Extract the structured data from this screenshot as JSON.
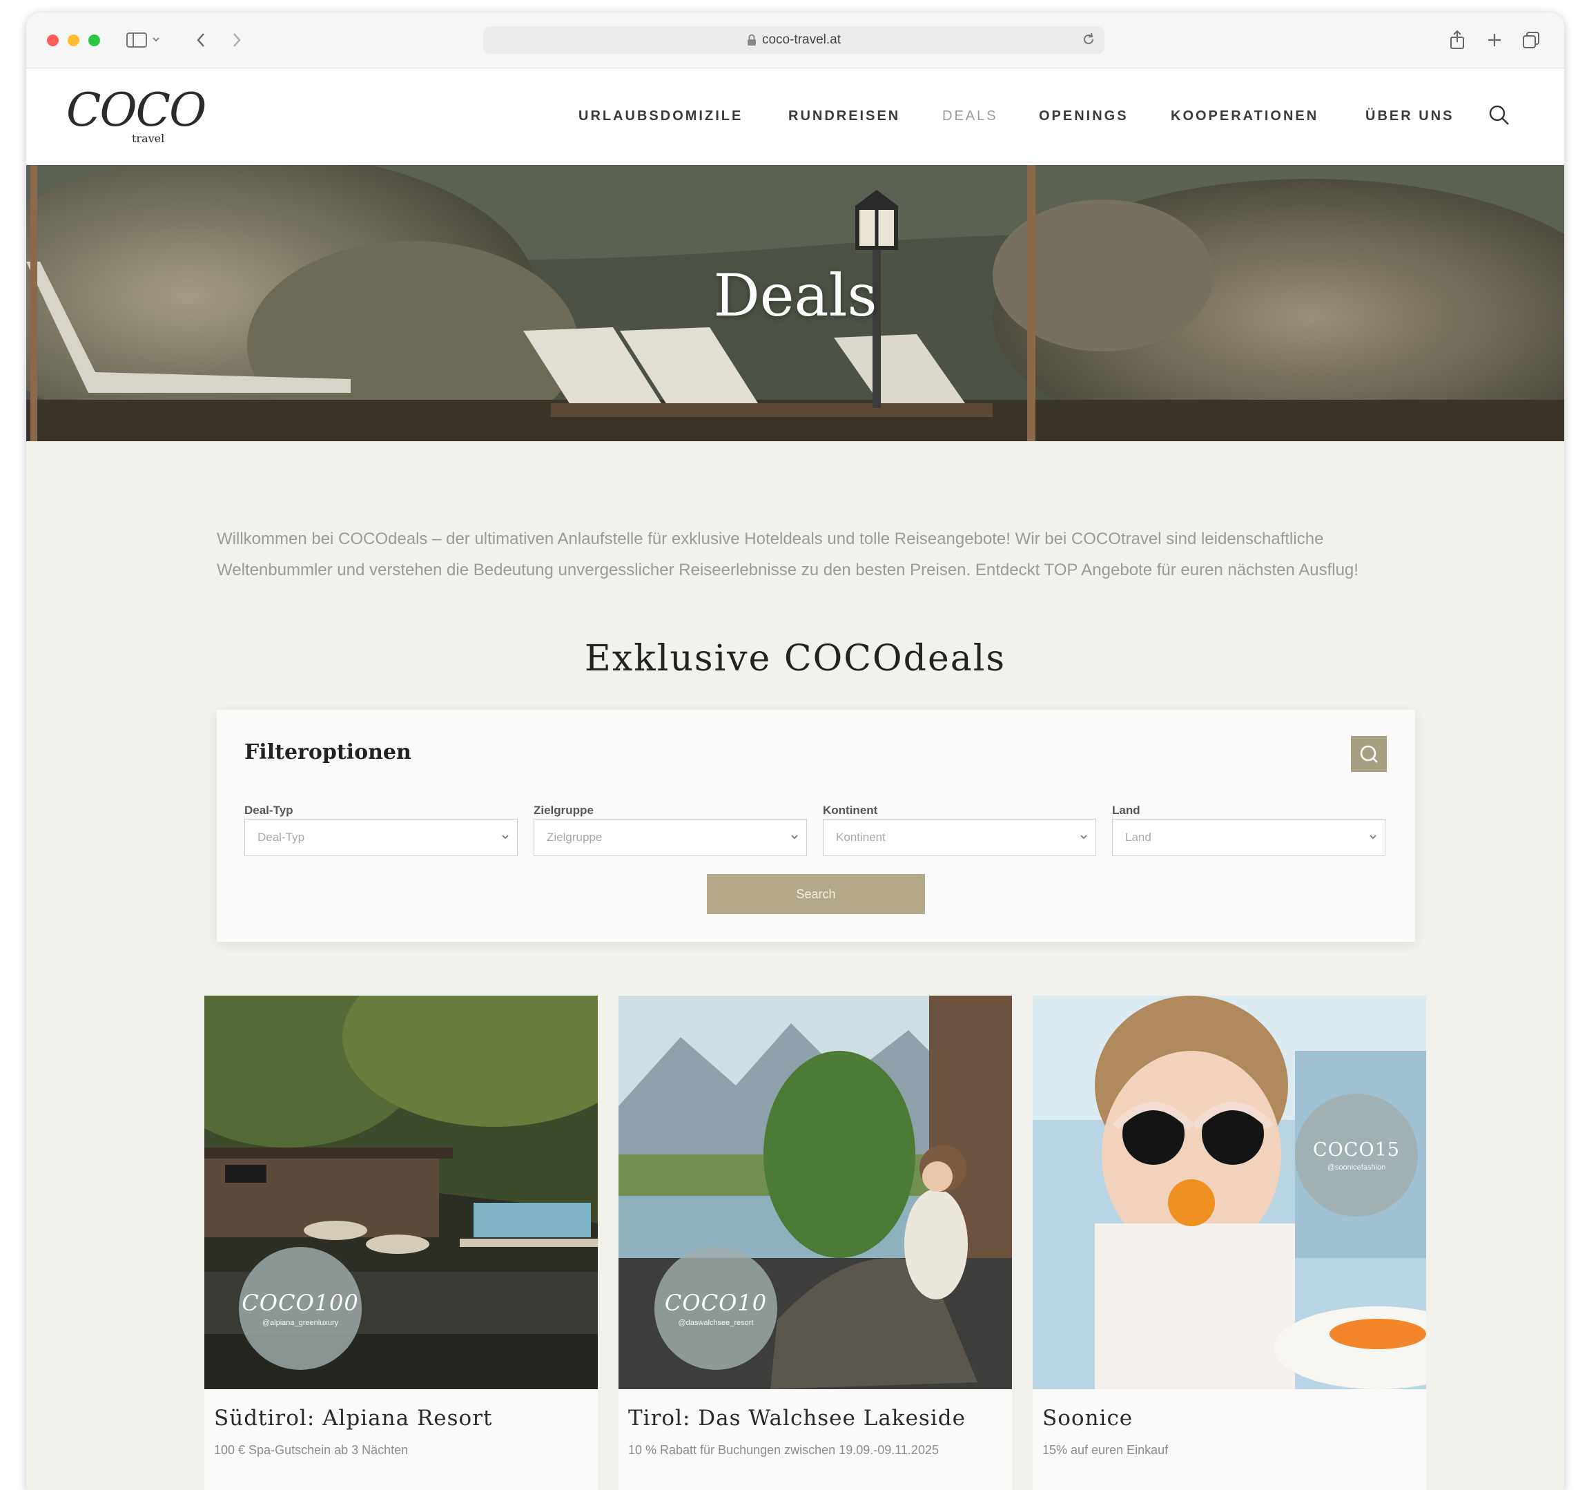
{
  "browser": {
    "url": "coco-travel.at"
  },
  "header": {
    "logo_main": "COCO",
    "logo_sub": "travel",
    "nav": [
      "URLAUBSDOMIZILE",
      "RUNDREISEN",
      "DEALS",
      "OPENINGS",
      "KOOPERATIONEN",
      "ÜBER UNS"
    ],
    "active_nav": "DEALS"
  },
  "hero": {
    "title": "Deals"
  },
  "intro": {
    "text": "Willkommen bei COCOdeals – der ultimativen Anlaufstelle für exklusive Hoteldeals und tolle Reiseangebote! Wir bei COCOtravel sind leidenschaftliche Weltenbummler und verstehen die Bedeutung unvergesslicher Reiseerlebnisse zu den besten Preisen. Entdeckt TOP Angebote für euren nächsten Ausflug!"
  },
  "section": {
    "title": "Exklusive COCOdeals"
  },
  "filter": {
    "title": "Filteroptionen",
    "fields": [
      {
        "label": "Deal-Typ",
        "placeholder": "Deal-Typ"
      },
      {
        "label": "Zielgruppe",
        "placeholder": "Zielgruppe"
      },
      {
        "label": "Kontinent",
        "placeholder": "Kontinent"
      },
      {
        "label": "Land",
        "placeholder": "Land"
      }
    ],
    "search_label": "Search"
  },
  "cards": [
    {
      "title": "Südtirol: Alpiana Resort",
      "subtitle": "100 € Spa-Gutschein ab 3 Nächten",
      "badge_code": "COCO100",
      "badge_handle": "@alpiana_greenluxury"
    },
    {
      "title": "Tirol: Das Walchsee Lakeside",
      "subtitle": "10 % Rabatt für Buchungen zwischen 19.09.-09.11.2025",
      "badge_code": "COCO10",
      "badge_handle": "@daswalchsee_resort"
    },
    {
      "title": "Soonice",
      "subtitle": "15% auf euren Einkauf",
      "badge_code": "COCO15",
      "badge_handle": "@soonicefashion"
    }
  ],
  "colors": {
    "accent": "#a79f81",
    "button": "#b3a98a",
    "page_bg": "#f3f1ec",
    "badge": "#a0acac"
  }
}
